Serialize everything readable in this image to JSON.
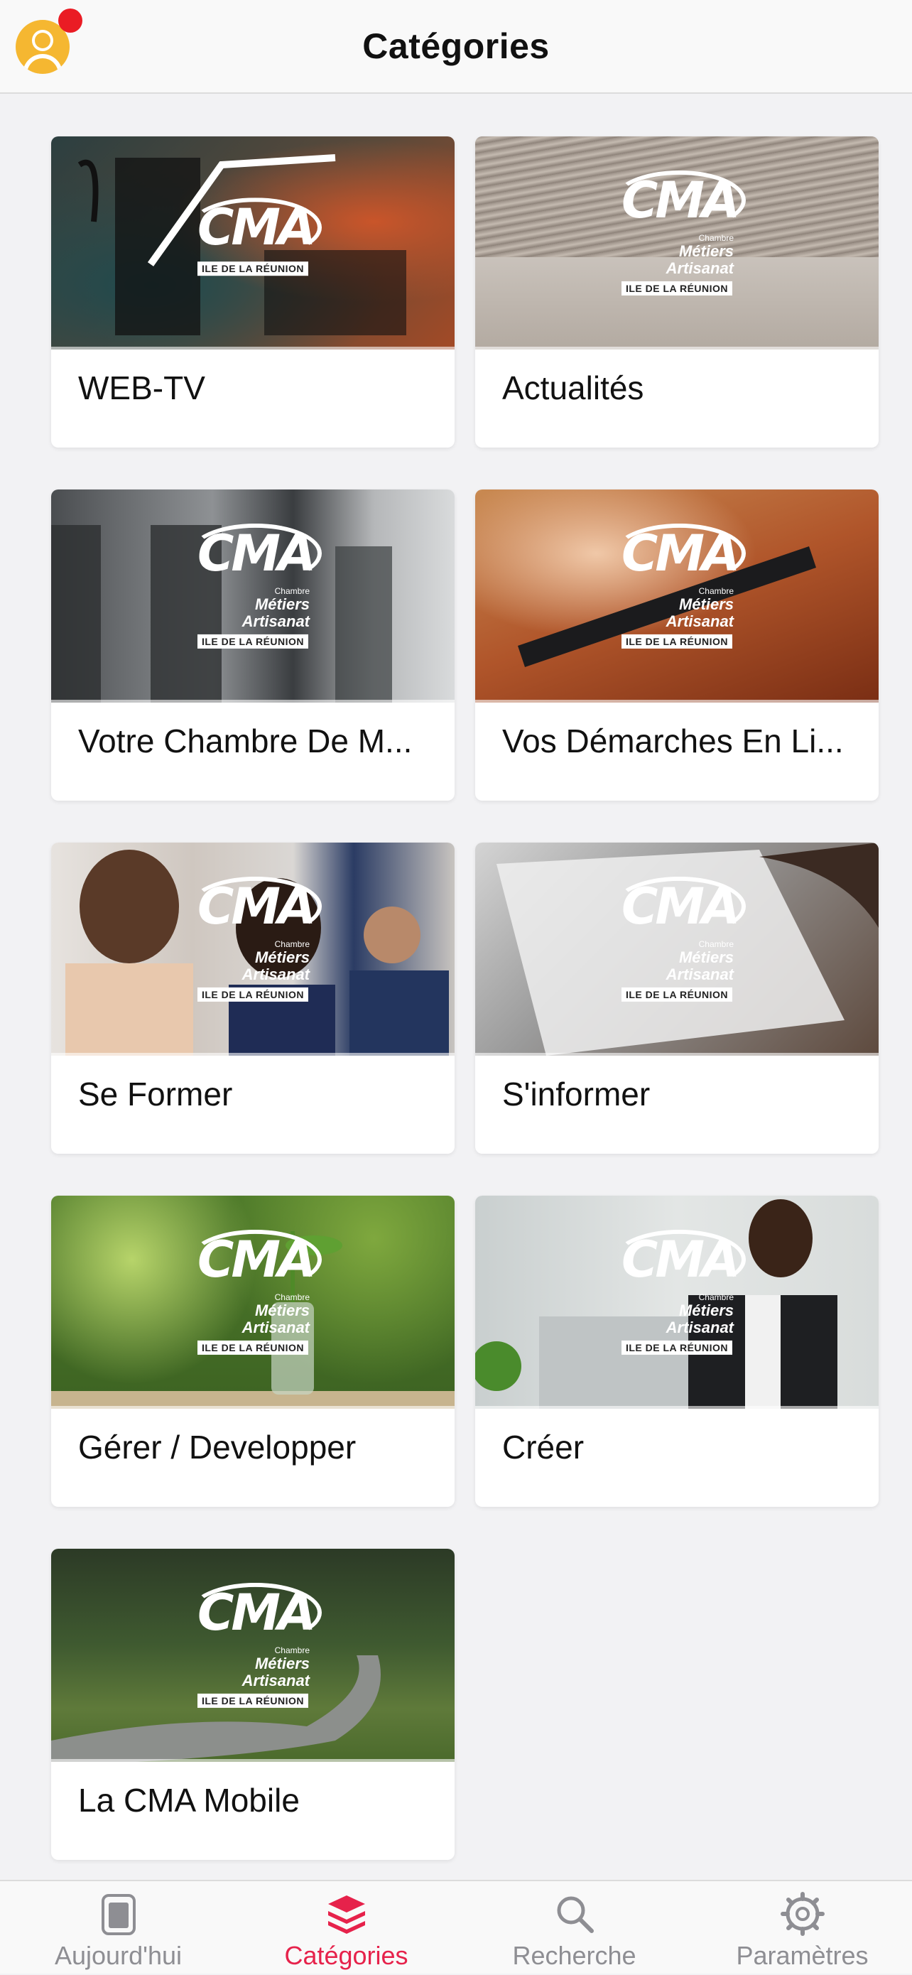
{
  "header": {
    "title": "Catégories",
    "accent": "#f5b731",
    "notification_color": "#ea1c24"
  },
  "logo": {
    "mark": "CMA",
    "line1": "Chambre",
    "line2": "Métiers",
    "line3": "Artisanat",
    "badge": "ILE DE LA RÉUNION"
  },
  "categories": [
    {
      "label": "WEB-TV",
      "image": "tv-camera-photo"
    },
    {
      "label": "Actualités",
      "image": "newspaper-photo"
    },
    {
      "label": "Votre Chambre De M...",
      "image": "building-entrance-photo"
    },
    {
      "label": "Vos Démarches En Li...",
      "image": "tablet-hands-photo"
    },
    {
      "label": "Se Former",
      "image": "students-photo"
    },
    {
      "label": "S'informer",
      "image": "writing-documents-photo"
    },
    {
      "label": "Gérer / Developper",
      "image": "coins-jar-plant-photo"
    },
    {
      "label": "Créer",
      "image": "businessman-laptop-photo"
    },
    {
      "label": "La CMA Mobile",
      "image": "forest-road-photo"
    }
  ],
  "tabbar": {
    "items": [
      {
        "label": "Aujourd'hui",
        "icon": "today-card-icon",
        "active": false
      },
      {
        "label": "Catégories",
        "icon": "layers-icon",
        "active": true
      },
      {
        "label": "Recherche",
        "icon": "search-icon",
        "active": false
      },
      {
        "label": "Paramètres",
        "icon": "gear-icon",
        "active": false
      }
    ],
    "active_color": "#e6224b",
    "inactive_color": "#8e8e93"
  }
}
